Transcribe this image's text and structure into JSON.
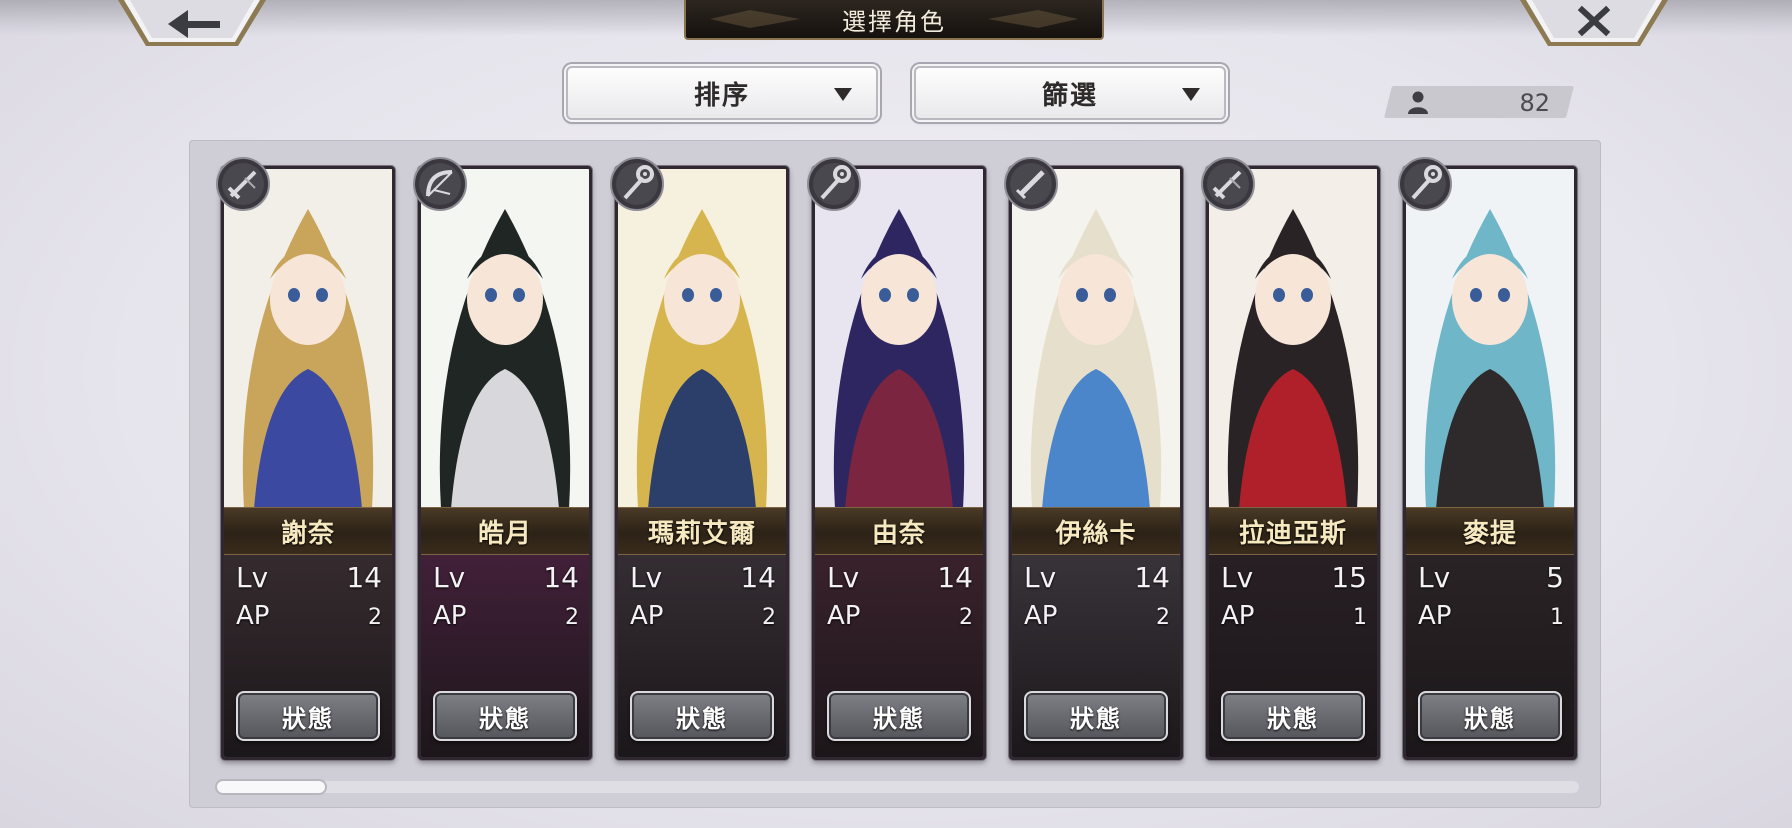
{
  "header": {
    "title": "選擇角色",
    "back_icon": "back-arrow-icon",
    "close_icon": "close-x-icon"
  },
  "controls": {
    "sort_label": "排序",
    "filter_label": "篩選",
    "count_icon": "person-icon",
    "character_count": "82"
  },
  "cards": {
    "lv_label": "Lv",
    "ap_label": "AP",
    "status_label": "狀態",
    "items": [
      {
        "name": "謝奈",
        "level": "14",
        "ap": "2",
        "weapon_icon": "sword-icon",
        "accent": "#c9a55b"
      },
      {
        "name": "皓月",
        "level": "14",
        "ap": "2",
        "weapon_icon": "bow-icon",
        "accent": "#2f3b3a"
      },
      {
        "name": "瑪莉艾爾",
        "level": "14",
        "ap": "2",
        "weapon_icon": "staff-icon",
        "accent": "#d6b54e"
      },
      {
        "name": "由奈",
        "level": "14",
        "ap": "2",
        "weapon_icon": "staff-icon",
        "accent": "#3a2f6b"
      },
      {
        "name": "伊絲卡",
        "level": "14",
        "ap": "2",
        "weapon_icon": "dagger-icon",
        "accent": "#e8e0cf"
      },
      {
        "name": "拉迪亞斯",
        "level": "15",
        "ap": "1",
        "weapon_icon": "sword-icon",
        "accent": "#b0202a"
      },
      {
        "name": "麥提",
        "level": "5",
        "ap": "1",
        "weapon_icon": "staff-icon",
        "accent": "#6fb6c9"
      }
    ]
  },
  "colors": {
    "name_text": "#f6e8bf",
    "title_plate": "#1e1814",
    "frame_gold": "#8a7450"
  }
}
